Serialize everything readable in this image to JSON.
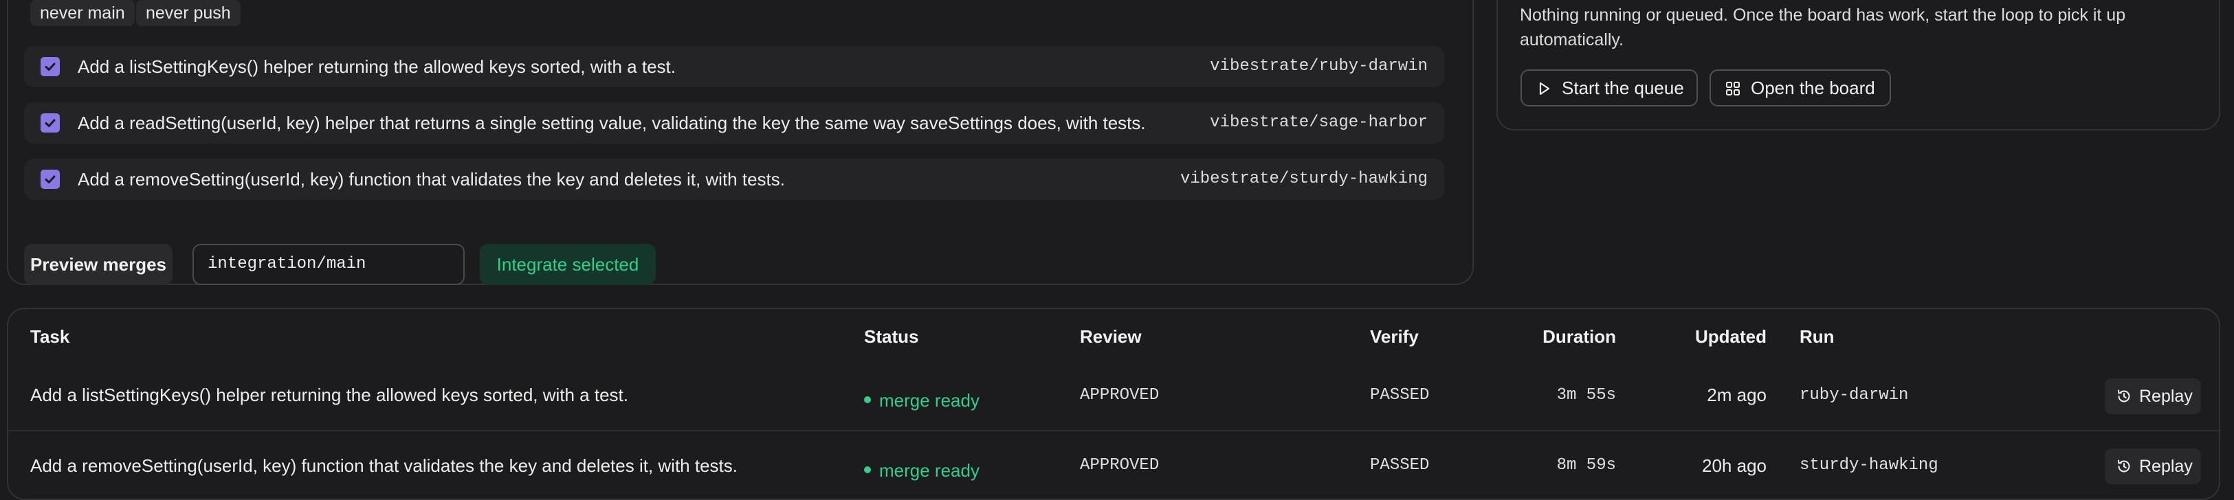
{
  "tags": [
    "never main",
    "never push"
  ],
  "tasks": [
    {
      "label": "Add a listSettingKeys() helper returning the allowed keys sorted, with a test.",
      "branch": "vibestrate/ruby-darwin",
      "checked": true
    },
    {
      "label": "Add a readSetting(userId, key) helper that returns a single setting value, validating the key the same way saveSettings does, with tests.",
      "branch": "vibestrate/sage-harbor",
      "checked": true
    },
    {
      "label": "Add a removeSetting(userId, key) function that validates the key and deletes it, with tests.",
      "branch": "vibestrate/sturdy-hawking",
      "checked": true
    }
  ],
  "merge": {
    "preview_label": "Preview merges",
    "target_branch": "integration/main",
    "integrate_label": "Integrate selected"
  },
  "queue": {
    "message": "Nothing running or queued. Once the board has work, start the loop to pick it up automatically.",
    "start_label": "Start the queue",
    "board_label": "Open the board"
  },
  "table": {
    "headers": {
      "task": "Task",
      "status": "Status",
      "review": "Review",
      "verify": "Verify",
      "duration": "Duration",
      "updated": "Updated",
      "run": "Run"
    },
    "rows": [
      {
        "task": "Add a listSettingKeys() helper returning the allowed keys sorted, with a test.",
        "status": "merge ready",
        "review": "APPROVED",
        "verify": "PASSED",
        "duration": "3m 55s",
        "updated": "2m ago",
        "run": "ruby-darwin",
        "action": "Replay"
      },
      {
        "task": "Add a removeSetting(userId, key) function that validates the key and deletes it, with tests.",
        "status": "merge ready",
        "review": "APPROVED",
        "verify": "PASSED",
        "duration": "8m 59s",
        "updated": "20h ago",
        "run": "sturdy-hawking",
        "action": "Replay"
      }
    ]
  },
  "colors": {
    "accent_purple": "#8b78e6",
    "success_green": "#2fd08a",
    "background": "#1b1b1d"
  },
  "icons": [
    "checkbox-checked-icon",
    "play-icon",
    "grid-icon",
    "history-icon"
  ]
}
